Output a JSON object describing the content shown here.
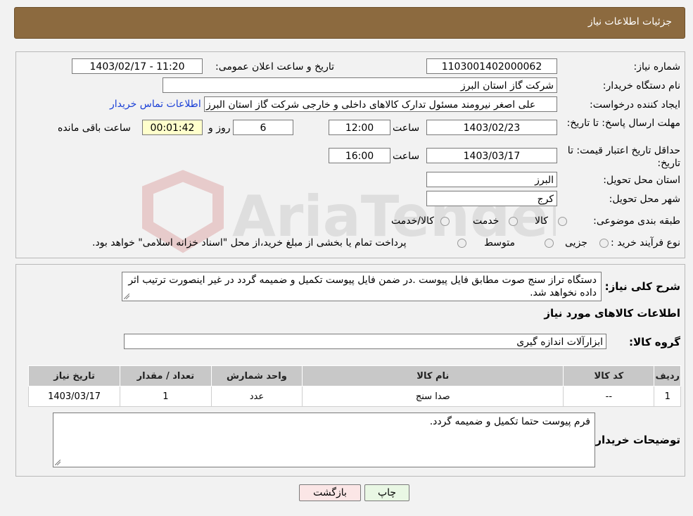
{
  "header": {
    "title": "جزئیات اطلاعات نیاز"
  },
  "form": {
    "need_number_label": "شماره نیاز:",
    "need_number": "1103001402000062",
    "announce_label": "تاریخ و ساعت اعلان عمومی:",
    "announce_value": "1403/02/17 - 11:20",
    "buyer_org_label": "نام دستگاه خریدار:",
    "buyer_org": "شرکت گاز استان البرز",
    "requester_label": "ایجاد کننده درخواست:",
    "requester": "علی اصغر نیرومند مسئول تدارک کالاهای داخلی و خارجی شرکت گاز استان البرز",
    "contact_link": "اطلاعات تماس خریدار",
    "deadline_label": "مهلت ارسال پاسخ: تا تاریخ:",
    "deadline_date": "1403/02/23",
    "time_label": "ساعت",
    "deadline_time": "12:00",
    "days_value": "6",
    "days_label": "روز و",
    "remaining_time": "00:01:42",
    "remaining_label": "ساعت باقی مانده",
    "price_validity_label": "حداقل تاریخ اعتبار قیمت: تا تاریخ:",
    "price_validity_date": "1403/03/17",
    "price_validity_time": "16:00",
    "province_label": "استان محل تحویل:",
    "province": "البرز",
    "city_label": "شهر محل تحویل:",
    "city": "کرج",
    "category_label": "طبقه بندی موضوعی:",
    "category_options": [
      "کالا",
      "خدمت",
      "کالا/خدمت"
    ],
    "process_label": "نوع فرآیند خرید :",
    "process_options": [
      "جزیی",
      "متوسط"
    ],
    "process_note": "پرداخت تمام یا بخشی از مبلغ خرید،از محل \"اسناد خزانه اسلامی\" خواهد بود."
  },
  "details": {
    "summary_label": "شرح کلی نیاز:",
    "summary_text": "دستگاه تراز سنج صوت مطابق فایل پیوست .در ضمن فایل پیوست تکمیل و ضمیمه گردد در غیر اینصورت ترتیب اثر داده نخواهد شد.",
    "goods_info_title": "اطلاعات کالاهای مورد نیاز",
    "goods_group_label": "گروه کالا:",
    "goods_group": "ابزارآلات اندازه گیری",
    "table_headers": [
      "ردیف",
      "کد کالا",
      "نام کالا",
      "واحد شمارش",
      "تعداد / مقدار",
      "تاریخ نیاز"
    ],
    "rows": [
      [
        "1",
        "--",
        "صدا سنج",
        "عدد",
        "1",
        "1403/03/17"
      ]
    ],
    "buyer_notes_label": "توضیحات خریدار:",
    "buyer_notes": "فرم پیوست حتما تکمیل و ضمیمه گردد."
  },
  "buttons": {
    "print": "چاپ",
    "back": "بازگشت"
  },
  "watermark": {
    "text": "AriaTender.net"
  }
}
